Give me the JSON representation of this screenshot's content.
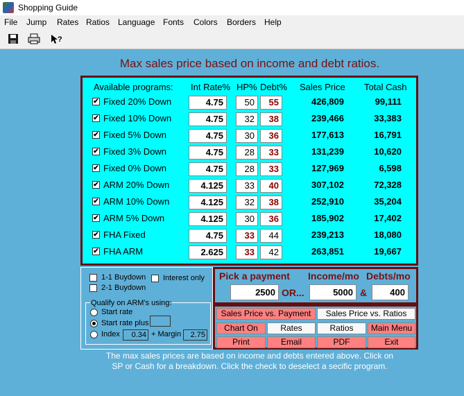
{
  "window": {
    "title": "Shopping Guide"
  },
  "menu": [
    "File",
    "Jump",
    "Rates",
    "Ratios",
    "Language",
    "Fonts",
    "Colors",
    "Borders",
    "Help"
  ],
  "toolbar": {
    "icons": [
      "save-icon",
      "print-icon",
      "help-icon"
    ]
  },
  "heading": "Max sales price based on income and debt ratios.",
  "table": {
    "headers": {
      "programs": "Available programs:",
      "rate": "Int Rate%",
      "hp": "HP%",
      "debt": "Debt%",
      "price": "Sales Price",
      "cash": "Total Cash"
    },
    "rows": [
      {
        "checked": "✔",
        "program": "Fixed 20% Down",
        "rate": "4.75",
        "hp": "50",
        "debt": "55",
        "price": "426,809",
        "cash": "99,111"
      },
      {
        "checked": "✔",
        "program": "Fixed 10% Down",
        "rate": "4.75",
        "hp": "32",
        "debt": "38",
        "price": "239,466",
        "cash": "33,383"
      },
      {
        "checked": "✔",
        "program": "Fixed 5% Down",
        "rate": "4.75",
        "hp": "30",
        "debt": "36",
        "price": "177,613",
        "cash": "16,791"
      },
      {
        "checked": "✔",
        "program": "Fixed 3% Down",
        "rate": "4.75",
        "hp": "28",
        "debt": "33",
        "price": "131,239",
        "cash": "10,620"
      },
      {
        "checked": "✔",
        "program": "Fixed 0% Down",
        "rate": "4.75",
        "hp": "28",
        "debt": "33",
        "price": "127,969",
        "cash": "6,598"
      },
      {
        "checked": "✔",
        "program": "ARM 20% Down",
        "rate": "4.125",
        "hp": "33",
        "debt": "40",
        "price": "307,102",
        "cash": "72,328"
      },
      {
        "checked": "✔",
        "program": "ARM 10% Down",
        "rate": "4.125",
        "hp": "32",
        "debt": "38",
        "price": "252,910",
        "cash": "35,204"
      },
      {
        "checked": "✔",
        "program": "ARM 5% Down",
        "rate": "4.125",
        "hp": "30",
        "debt": "36",
        "price": "185,902",
        "cash": "17,402"
      },
      {
        "checked": "✔",
        "program": "FHA Fixed",
        "rate": "4.75",
        "hp": "33",
        "debt": "44",
        "price": "239,213",
        "cash": "18,080"
      },
      {
        "checked": "✔",
        "program": "FHA ARM",
        "rate": "2.625",
        "hp": "33",
        "debt": "42",
        "price": "263,851",
        "cash": "19,667"
      }
    ]
  },
  "options": {
    "buydown_1_1": "1-1 Buydown",
    "buydown_2_1": "2-1 Buydown",
    "interest_only": "Interest only",
    "qualify_title": "Qualify on ARM's using:",
    "start_rate": "Start rate",
    "start_rate_plus": "Start rate plus",
    "start_rate_plus_value": "",
    "index_label": "Index",
    "index_value": "0.34",
    "plus_margin": "+  Margin",
    "margin_value": "2.75"
  },
  "payment": {
    "pick_label": "Pick a payment",
    "income_label": "Income/mo",
    "debts_label": "Debts/mo",
    "payment_value": "2500",
    "or_text": "OR...",
    "income_value": "5000",
    "amp": "&",
    "debts_value": "400"
  },
  "buttons": {
    "sp_vs_payment": "Sales Price vs. Payment",
    "sp_vs_ratios": "Sales Price vs. Ratios",
    "chart_on": "Chart On",
    "rates": "Rates",
    "ratios": "Ratios",
    "main_menu": "Main Menu",
    "print": "Print",
    "email": "Email",
    "pdf": "PDF",
    "exit": "Exit"
  },
  "footer": {
    "line1": "The max sales prices are based on income and debts entered above. Click on",
    "line2": "SP or Cash for a breakdown.  Click the check to deselect a secific program."
  },
  "colors": {
    "background": "#5fb0d8",
    "panel": "#00ffff",
    "border": "#6a0d0d",
    "heading": "#7a1010",
    "button_red": "#ff8080"
  }
}
